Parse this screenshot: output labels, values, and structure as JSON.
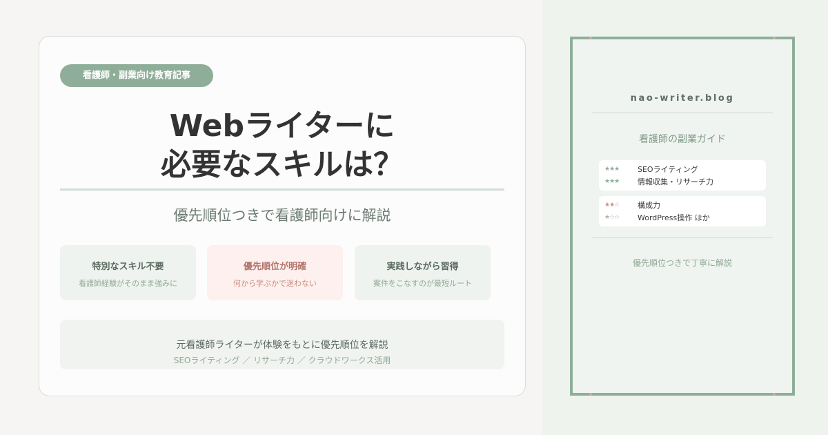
{
  "card": {
    "tag": "看護師・副業向け教育記事",
    "headline_line1": "Webライターに",
    "headline_line2": "必要なスキルは？",
    "subheading": "優先順位つきで看護師向けに解説",
    "features": [
      {
        "title": "特別なスキル不要",
        "desc": "看護師経験がそのまま強みに"
      },
      {
        "title": "優先順位が明確",
        "desc": "何から学ぶかで迷わない"
      },
      {
        "title": "実践しながら習得",
        "desc": "案件をこなすのが最短ルート"
      }
    ],
    "bottom_line1": "元看護師ライターが体験をもとに優先順位を解説",
    "bottom_line2": "SEOライティング ／ リサーチ力 ／ クラウドワークス活用"
  },
  "book": {
    "blog_name": "nao-writer.blog",
    "subtitle": "看護師の副業ガイド",
    "skills": [
      {
        "stars": "★★★",
        "name": "SEOライティング",
        "star_color": "#8fae99"
      },
      {
        "stars": "★★★",
        "name": "情報収集・リサーチ力",
        "star_color": "#8fae99"
      },
      {
        "stars": "★★☆",
        "name": "構成力",
        "star_color": "#c98c82"
      },
      {
        "stars": "★☆☆",
        "name": "WordPress操作 ほか",
        "star_color": "#a9b9ae"
      }
    ],
    "footer": "優先順位つきで丁寧に解説"
  },
  "colors": {
    "sage": "#8fae99",
    "rose": "#c98c82",
    "text_dark": "#333333"
  }
}
